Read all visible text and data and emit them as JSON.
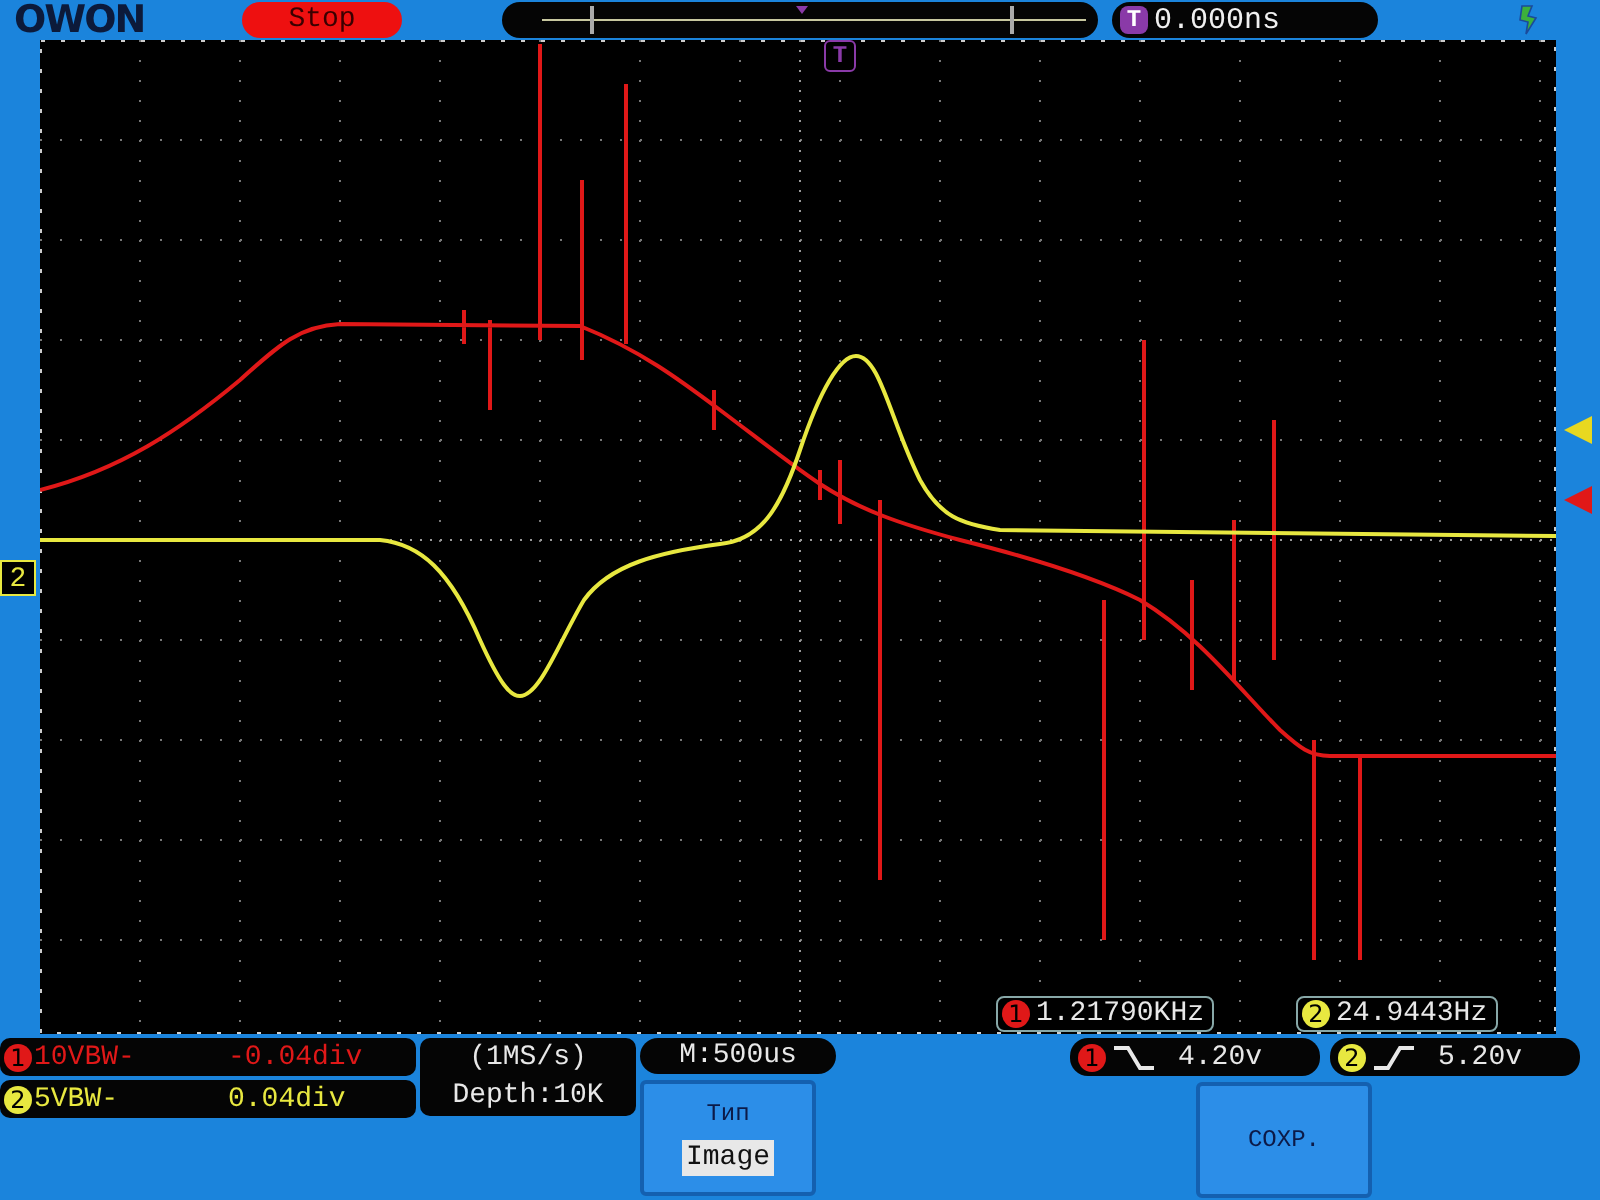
{
  "header": {
    "logo": "OWON",
    "run_state": "Stop",
    "trigger_offset": {
      "badge": "T",
      "value": "0.000ns"
    }
  },
  "screen": {
    "trigger_marker": {
      "label": "T"
    },
    "ground_marker": {
      "label": "2",
      "color": "#e8e840"
    },
    "trigger_level_markers": [
      {
        "color": "#e8d820"
      },
      {
        "color": "#e01818"
      }
    ],
    "measurements": [
      {
        "channel": "1",
        "color": "#e01818",
        "value": "1.21790KHz"
      },
      {
        "channel": "2",
        "color": "#e8e840",
        "value": "24.9443Hz"
      }
    ]
  },
  "channels": [
    {
      "number": "1",
      "color": "#e01818",
      "scale": "10VBW-",
      "offset": "-0.04div"
    },
    {
      "number": "2",
      "color": "#e8e840",
      "scale": "5VBW-",
      "offset": "0.04div"
    }
  ],
  "acquisition": {
    "rate": "(1MS/s)",
    "depth": "Depth:10K"
  },
  "timebase": "M:500us",
  "triggers": [
    {
      "channel": "1",
      "color": "#e01818",
      "kind": "falling",
      "voltage": "4.20v"
    },
    {
      "channel": "2",
      "color": "#e8e840",
      "kind": "rising",
      "voltage": "5.20v"
    }
  ],
  "softkeys": [
    {
      "title": "Тип",
      "value": "Image"
    },
    {
      "title": "СОХР."
    }
  ]
}
